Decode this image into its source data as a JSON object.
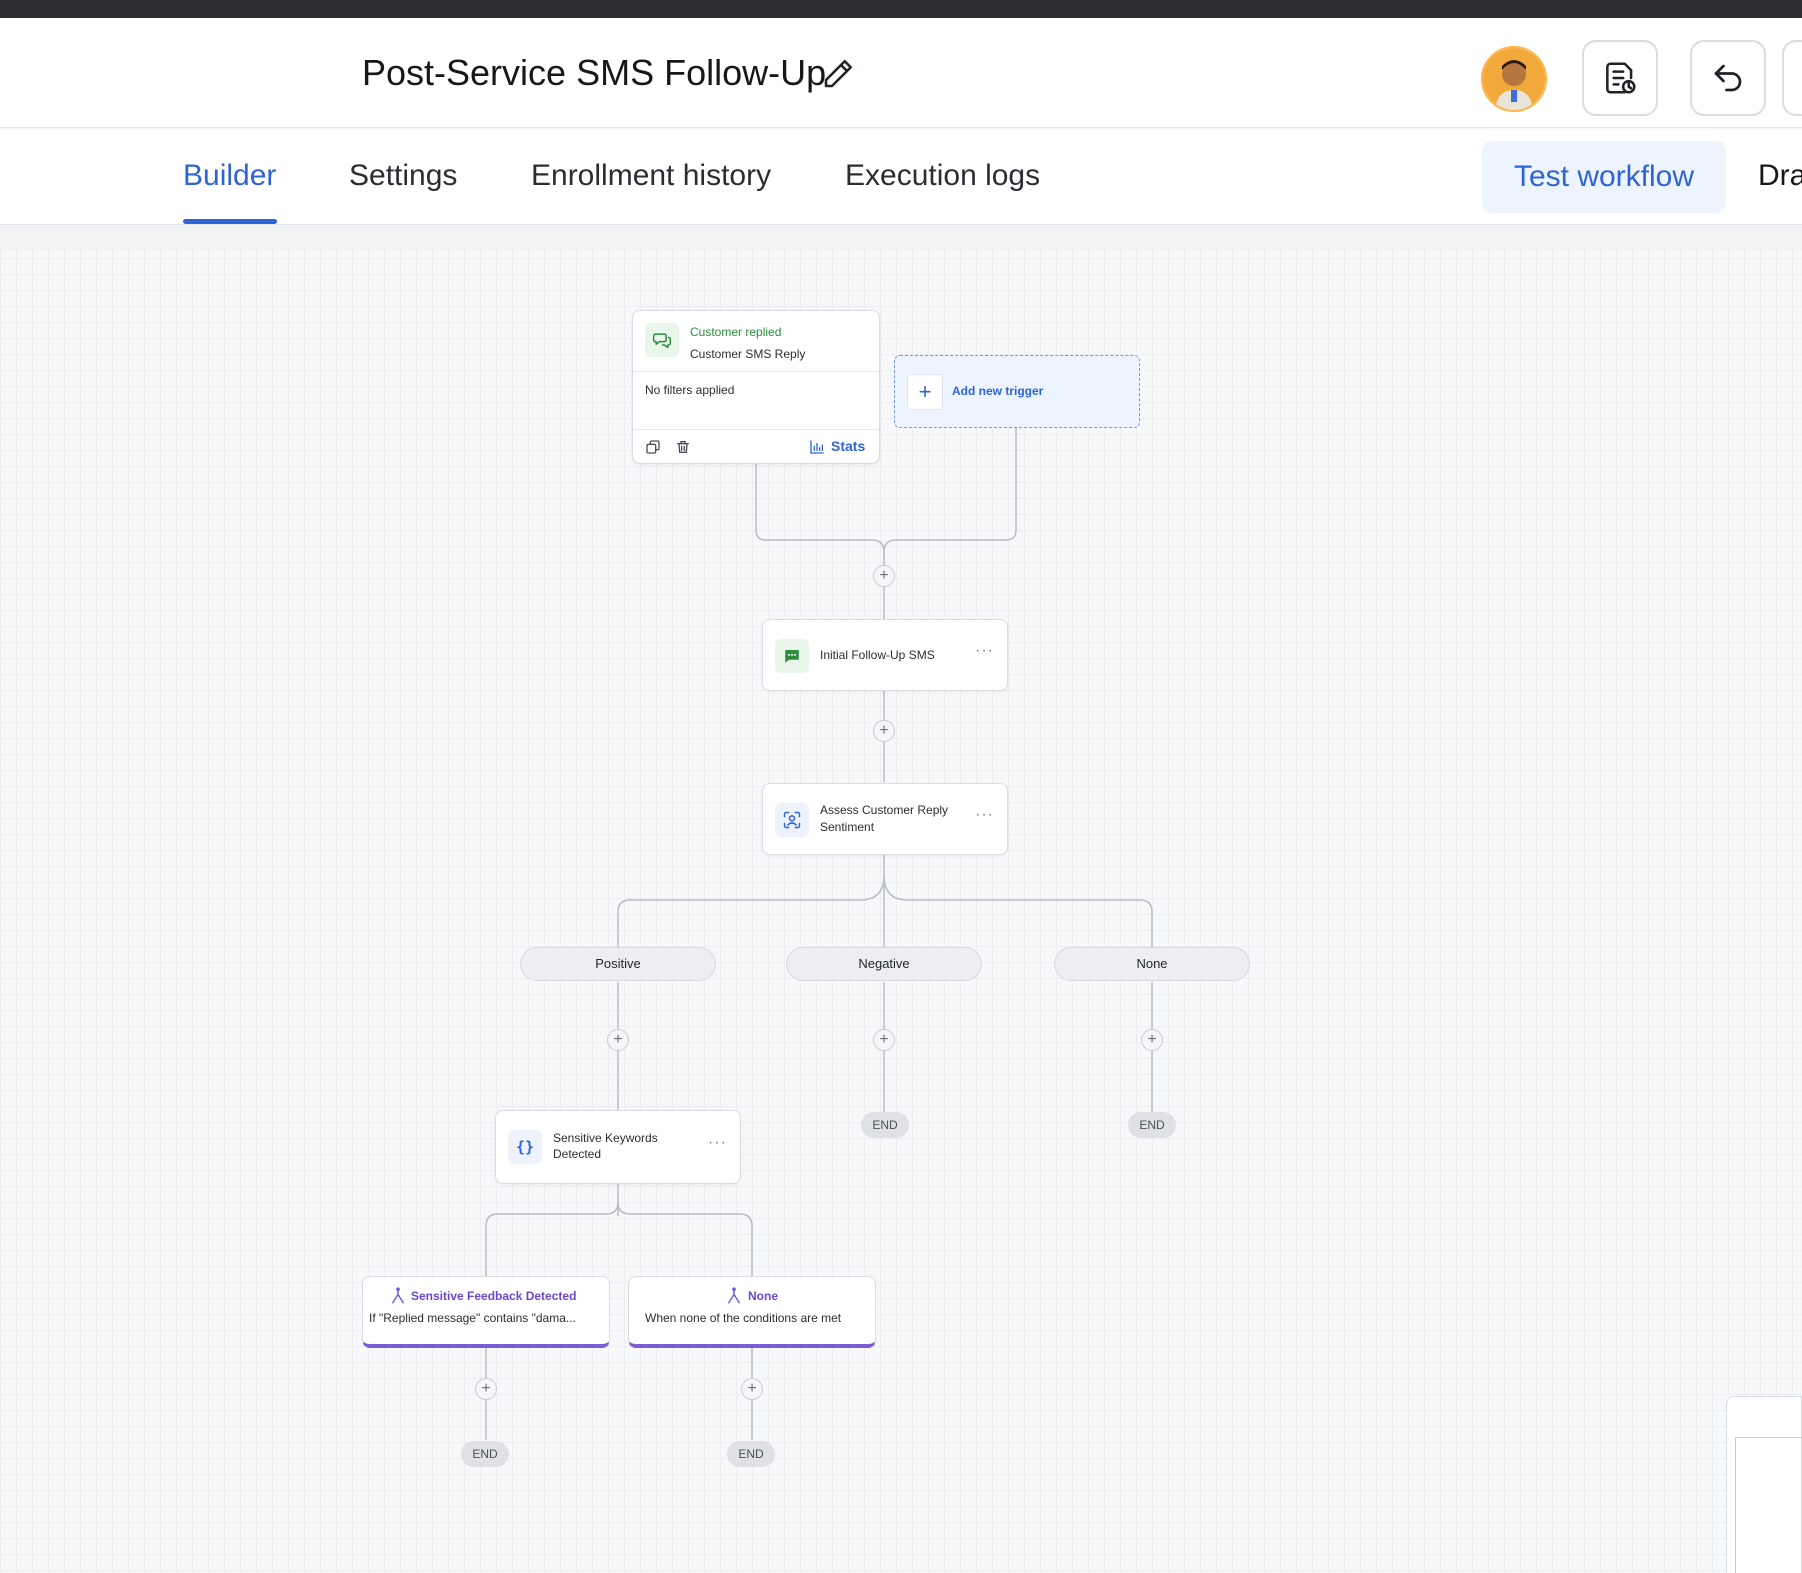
{
  "header": {
    "title": "Post-Service SMS Follow-Up"
  },
  "tabs": {
    "builder": "Builder",
    "settings": "Settings",
    "enrollment": "Enrollment history",
    "execution": "Execution logs",
    "test_workflow": "Test workflow",
    "draft_partial": "Dra"
  },
  "trigger": {
    "event": "Customer replied",
    "name": "Customer SMS Reply",
    "filters": "No filters applied",
    "stats_label": "Stats",
    "add_trigger": "Add new trigger"
  },
  "nodes": {
    "initial_sms": "Initial Follow-Up SMS",
    "assess_line1": "Assess Customer Reply",
    "assess_line2": "Sentiment",
    "keywords_line1": "Sensitive Keywords",
    "keywords_line2": "Detected"
  },
  "branches": {
    "positive": "Positive",
    "negative": "Negative",
    "none": "None"
  },
  "conditions": {
    "sensitive_title": "Sensitive Feedback Detected",
    "sensitive_desc": "If \"Replied message\" contains \"dama...",
    "none_title": "None",
    "none_desc": "When none of the conditions are met"
  },
  "end_label": "END",
  "colors": {
    "accent": "#2f64d6",
    "trigger_green": "#2e8b3e",
    "condition_purple": "#7b5ed6"
  }
}
